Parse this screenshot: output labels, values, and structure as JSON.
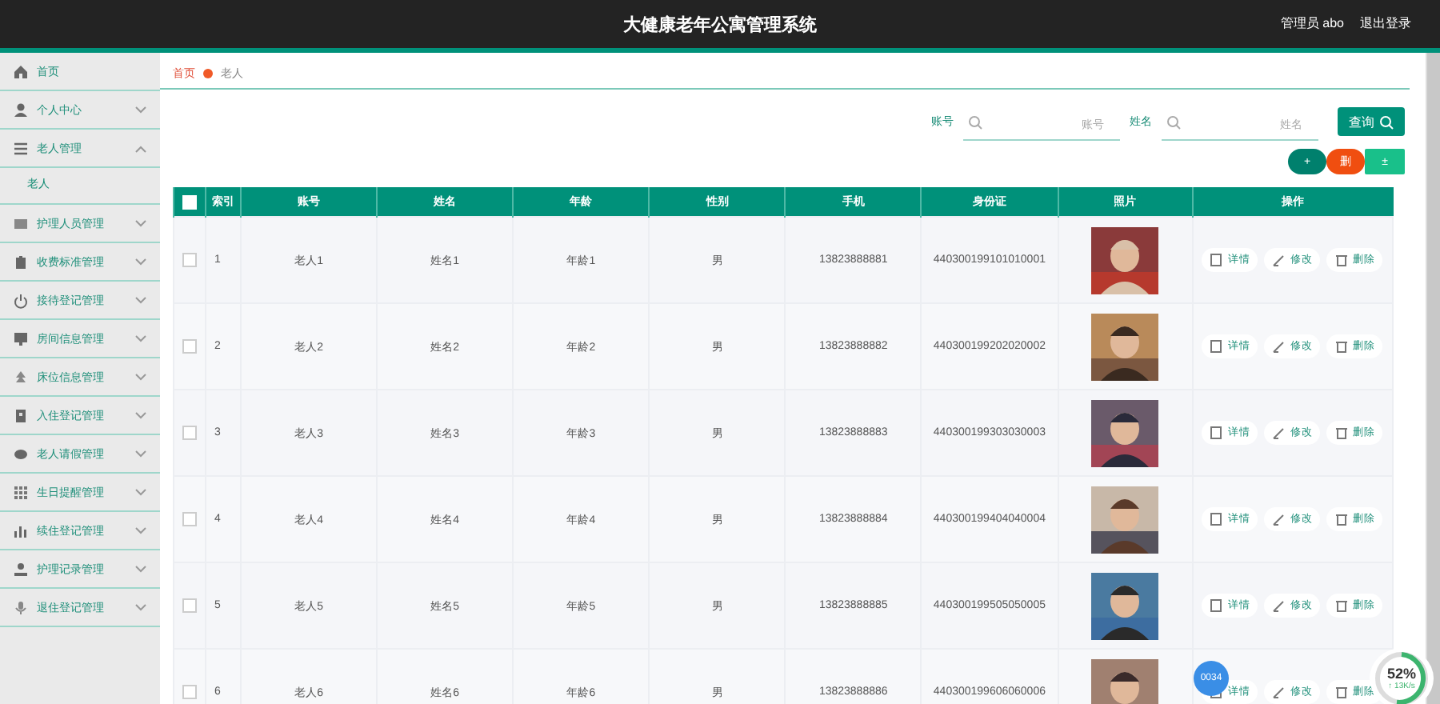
{
  "header": {
    "title": "大健康老年公寓管理系统",
    "user": "管理员 abo",
    "logout": "退出登录"
  },
  "sidebar": {
    "items": [
      {
        "label": "首页"
      },
      {
        "label": "个人中心",
        "expanded": false
      },
      {
        "label": "老人管理",
        "expanded": true,
        "children": [
          {
            "label": "老人",
            "selected": true
          }
        ]
      },
      {
        "label": "护理人员管理",
        "expanded": false
      },
      {
        "label": "收费标准管理",
        "expanded": false
      },
      {
        "label": "接待登记管理",
        "expanded": false
      },
      {
        "label": "房间信息管理",
        "expanded": false
      },
      {
        "label": "床位信息管理",
        "expanded": false
      },
      {
        "label": "入住登记管理",
        "expanded": false
      },
      {
        "label": "老人请假管理",
        "expanded": false
      },
      {
        "label": "生日提醒管理",
        "expanded": false
      },
      {
        "label": "续住登记管理",
        "expanded": false
      },
      {
        "label": "护理记录管理",
        "expanded": false
      },
      {
        "label": "退住登记管理",
        "expanded": false
      }
    ]
  },
  "breadcrumb": [
    "首页",
    "老人"
  ],
  "search": {
    "fields": [
      {
        "label": "账号",
        "placeholder": "账号"
      },
      {
        "label": "姓名",
        "placeholder": "姓名"
      }
    ],
    "button": "查询"
  },
  "actions": [
    {
      "kind": "add",
      "label": "+"
    },
    {
      "kind": "delete",
      "label": "删"
    },
    {
      "kind": "stats",
      "label": "±"
    }
  ],
  "table": {
    "select_all": false,
    "columns": [
      "索引",
      "账号",
      "姓名",
      "年龄",
      "性别",
      "手机",
      "身份证",
      "照片",
      "操作"
    ],
    "rows": [
      {
        "checked": false,
        "cells": [
          "1",
          "老人1",
          "姓名1",
          "年龄1",
          "男",
          "13823888881",
          "440300199101010001"
        ],
        "actions": [
          "详情",
          "修改",
          "删除"
        ]
      },
      {
        "checked": false,
        "cells": [
          "2",
          "老人2",
          "姓名2",
          "年龄2",
          "男",
          "13823888882",
          "440300199202020002"
        ],
        "actions": [
          "详情",
          "修改",
          "删除"
        ]
      },
      {
        "checked": false,
        "cells": [
          "3",
          "老人3",
          "姓名3",
          "年龄3",
          "男",
          "13823888883",
          "440300199303030003"
        ],
        "actions": [
          "详情",
          "修改",
          "删除"
        ]
      },
      {
        "checked": false,
        "cells": [
          "4",
          "老人4",
          "姓名4",
          "年龄4",
          "男",
          "13823888884",
          "440300199404040004"
        ],
        "actions": [
          "详情",
          "修改",
          "删除"
        ]
      },
      {
        "checked": false,
        "cells": [
          "5",
          "老人5",
          "姓名5",
          "年龄5",
          "男",
          "13823888885",
          "440300199505050005"
        ],
        "actions": [
          "详情",
          "修改",
          "删除"
        ]
      },
      {
        "checked": false,
        "cells": [
          "6",
          "老人6",
          "姓名6",
          "年龄6",
          "男",
          "13823888886",
          "440300199606060006"
        ],
        "actions": [
          "详情",
          "修改",
          "删除"
        ]
      }
    ]
  },
  "overlays": {
    "badge": "0034",
    "monitor": {
      "percent": "52%",
      "rate": "↑ 13K/s"
    }
  }
}
